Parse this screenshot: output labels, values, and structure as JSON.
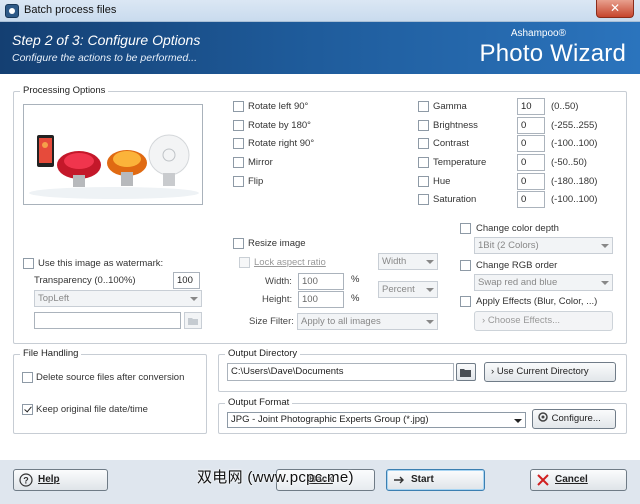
{
  "window": {
    "title": "Batch process files",
    "close_glyph": "✕"
  },
  "header": {
    "step": "Step 2 of 3: Configure Options",
    "subtitle": "Configure the actions to be performed...",
    "brand": "Ashampoo®",
    "product": "Photo Wizard"
  },
  "processing": {
    "legend": "Processing Options",
    "preview_alt": "preview-image",
    "transform": [
      {
        "label": "Rotate left 90°",
        "checked": false
      },
      {
        "label": "Rotate by 180°",
        "checked": false
      },
      {
        "label": "Rotate right 90°",
        "checked": false
      },
      {
        "label": "Mirror",
        "checked": false
      },
      {
        "label": "Flip",
        "checked": false
      }
    ],
    "adjust": [
      {
        "label": "Gamma",
        "value": "10",
        "range": "(0..50)"
      },
      {
        "label": "Brightness",
        "value": "0",
        "range": "(-255..255)"
      },
      {
        "label": "Contrast",
        "value": "0",
        "range": "(-100..100)"
      },
      {
        "label": "Temperature",
        "value": "0",
        "range": "(-50..50)"
      },
      {
        "label": "Hue",
        "value": "0",
        "range": "(-180..180)"
      },
      {
        "label": "Saturation",
        "value": "0",
        "range": "(-100..100)"
      }
    ],
    "watermark": {
      "label": "Use this image as watermark:",
      "transparency_label": "Transparency (0..100%)",
      "transparency_value": "100",
      "position": "TopLeft",
      "file_value": ""
    },
    "resize": {
      "label": "Resize image",
      "lock_label": "Lock aspect ratio",
      "width_label": "Width:",
      "width_value": "100",
      "height_label": "Height:",
      "height_value": "100",
      "percent_unit": "%",
      "dim_combo": "Width",
      "unit_combo": "Percent",
      "filter_label": "Size Filter:",
      "filter_value": "Apply to all images"
    },
    "color_depth": {
      "label": "Change color depth",
      "value": "1Bit (2 Colors)"
    },
    "rgb_order": {
      "label": "Change RGB order",
      "value": "Swap red and blue"
    },
    "effects": {
      "label": "Apply Effects (Blur, Color, ...)",
      "button": "Choose Effects..."
    }
  },
  "file_handling": {
    "legend": "File Handling",
    "delete_label": "Delete source files after conversion",
    "delete_checked": false,
    "keep_label": "Keep original file date/time",
    "keep_checked": true
  },
  "output_directory": {
    "legend": "Output Directory",
    "path": "C:\\Users\\Dave\\Documents",
    "use_current_button": "Use Current Directory"
  },
  "output_format": {
    "legend": "Output Format",
    "value": "JPG - Joint Photographic Experts Group (*.jpg)",
    "configure_button": "Configure..."
  },
  "footer": {
    "help": "Help",
    "back": "Back",
    "start": "Start",
    "cancel": "Cancel",
    "watermark_text": "双电网 (www.pcpc.me)"
  }
}
